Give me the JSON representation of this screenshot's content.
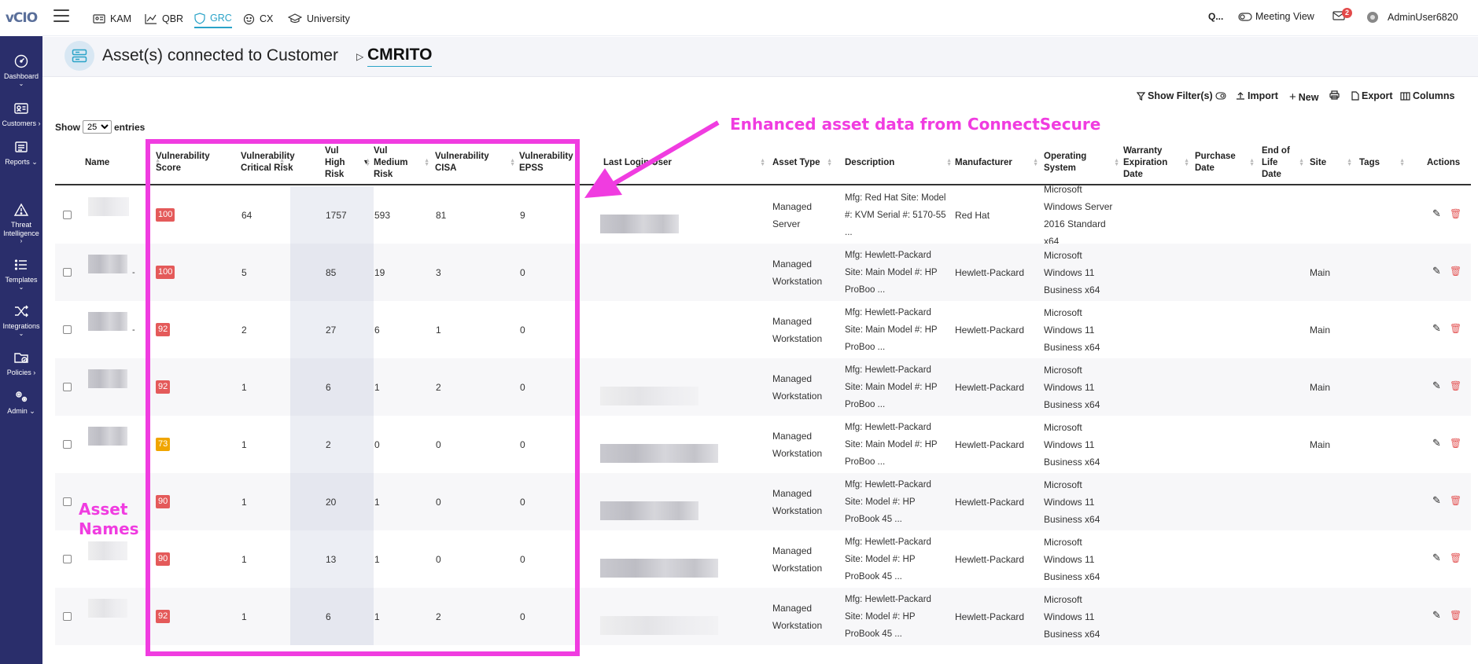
{
  "app": {
    "logo": "vCIO"
  },
  "sidebar": {
    "items": [
      {
        "label": "Dashboard",
        "icon": "gauge-icon"
      },
      {
        "label": "Customers",
        "icon": "id-card-icon"
      },
      {
        "label": "Reports",
        "icon": "report-icon"
      },
      {
        "label": "Threat Intelligence",
        "icon": "warning-triangle-icon"
      },
      {
        "label": "Templates",
        "icon": "list-icon"
      },
      {
        "label": "Integrations",
        "icon": "shuffle-icon"
      },
      {
        "label": "Policies",
        "icon": "folder-check-icon"
      },
      {
        "label": "Admin",
        "icon": "gears-icon"
      }
    ]
  },
  "topnav": {
    "tabs": [
      {
        "label": "KAM",
        "icon": "id-badge-icon"
      },
      {
        "label": "QBR",
        "icon": "line-chart-icon"
      },
      {
        "label": "GRC",
        "icon": "shield-icon",
        "active": true
      },
      {
        "label": "CX",
        "icon": "smiley-icon"
      },
      {
        "label": "University",
        "icon": "graduation-cap-icon"
      }
    ],
    "search_label": "Q...",
    "meeting_view": "Meeting View",
    "notifications_count": "2",
    "user": "AdminUser6820"
  },
  "header": {
    "title": "Asset(s) connected to Customer",
    "customer": "CMRITO"
  },
  "toolbar": {
    "show_filters": "Show Filter(s)",
    "import": "Import",
    "new": "New",
    "export": "Export",
    "columns": "Columns"
  },
  "entries": {
    "show": "Show",
    "value": "25",
    "suffix": "entries"
  },
  "table": {
    "columns": [
      "Name",
      "Vulnerability Score",
      "Vulnerability Critical Risk",
      "Vul High Risk",
      "Vul Medium Risk",
      "Vulnerability CISA",
      "Vulnerability EPSS",
      "Last Login User",
      "Asset Type",
      "Description",
      "Manufacturer",
      "Operating System",
      "Warranty Expiration Date",
      "Purchase Date",
      "End of Life Date",
      "Site",
      "Tags",
      "Actions"
    ],
    "rows": [
      {
        "score": "100",
        "score_color": "#e45a5a",
        "critical": "64",
        "high": "1757",
        "medium": "593",
        "cisa": "81",
        "epss": "9",
        "asset_type": "Managed Server",
        "description": "Mfg: Red Hat Site: Model #: KVM Serial #: 5170-55 ...",
        "manufacturer": "Red Hat",
        "os": "Microsoft Windows Server 2016 Standard x64",
        "site": ""
      },
      {
        "score": "100",
        "score_color": "#e45a5a",
        "critical": "5",
        "high": "85",
        "medium": "19",
        "cisa": "3",
        "epss": "0",
        "asset_type": "Managed Workstation",
        "description": "Mfg: Hewlett-Packard Site: Main Model #: HP ProBoo ...",
        "manufacturer": "Hewlett-Packard",
        "os": "Microsoft Windows 11 Business x64",
        "site": "Main"
      },
      {
        "score": "92",
        "score_color": "#e45a5a",
        "critical": "2",
        "high": "27",
        "medium": "6",
        "cisa": "1",
        "epss": "0",
        "asset_type": "Managed Workstation",
        "description": "Mfg: Hewlett-Packard Site: Main Model #: HP ProBoo ...",
        "manufacturer": "Hewlett-Packard",
        "os": "Microsoft Windows 11 Business x64",
        "site": "Main"
      },
      {
        "score": "92",
        "score_color": "#e45a5a",
        "critical": "1",
        "high": "6",
        "medium": "1",
        "cisa": "2",
        "epss": "0",
        "asset_type": "Managed Workstation",
        "description": "Mfg: Hewlett-Packard Site: Main Model #: HP ProBoo ...",
        "manufacturer": "Hewlett-Packard",
        "os": "Microsoft Windows 11 Business x64",
        "site": "Main"
      },
      {
        "score": "73",
        "score_color": "#f0a500",
        "critical": "1",
        "high": "2",
        "medium": "0",
        "cisa": "0",
        "epss": "0",
        "asset_type": "Managed Workstation",
        "description": "Mfg: Hewlett-Packard Site: Main Model #: HP ProBoo ...",
        "manufacturer": "Hewlett-Packard",
        "os": "Microsoft Windows 11 Business x64",
        "site": "Main"
      },
      {
        "score": "90",
        "score_color": "#e45a5a",
        "critical": "1",
        "high": "20",
        "medium": "1",
        "cisa": "0",
        "epss": "0",
        "asset_type": "Managed Workstation",
        "description": "Mfg: Hewlett-Packard Site: Model #: HP ProBook 45 ...",
        "manufacturer": "Hewlett-Packard",
        "os": "Microsoft Windows 11 Business x64",
        "site": ""
      },
      {
        "score": "90",
        "score_color": "#e45a5a",
        "critical": "1",
        "high": "13",
        "medium": "1",
        "cisa": "0",
        "epss": "0",
        "asset_type": "Managed Workstation",
        "description": "Mfg: Hewlett-Packard Site: Model #: HP ProBook 45 ...",
        "manufacturer": "Hewlett-Packard",
        "os": "Microsoft Windows 11 Business x64",
        "site": ""
      },
      {
        "score": "92",
        "score_color": "#e45a5a",
        "critical": "1",
        "high": "6",
        "medium": "1",
        "cisa": "2",
        "epss": "0",
        "asset_type": "Managed Workstation",
        "description": "Mfg: Hewlett-Packard Site: Model #: HP ProBook 45 ...",
        "manufacturer": "Hewlett-Packard",
        "os": "Microsoft Windows 11 Business x64",
        "site": ""
      }
    ]
  },
  "annotations": {
    "callout": "Enhanced asset data from ConnectSecure",
    "names_line1": "Asset",
    "names_line2": "Names",
    "color": "#f03ce0"
  }
}
